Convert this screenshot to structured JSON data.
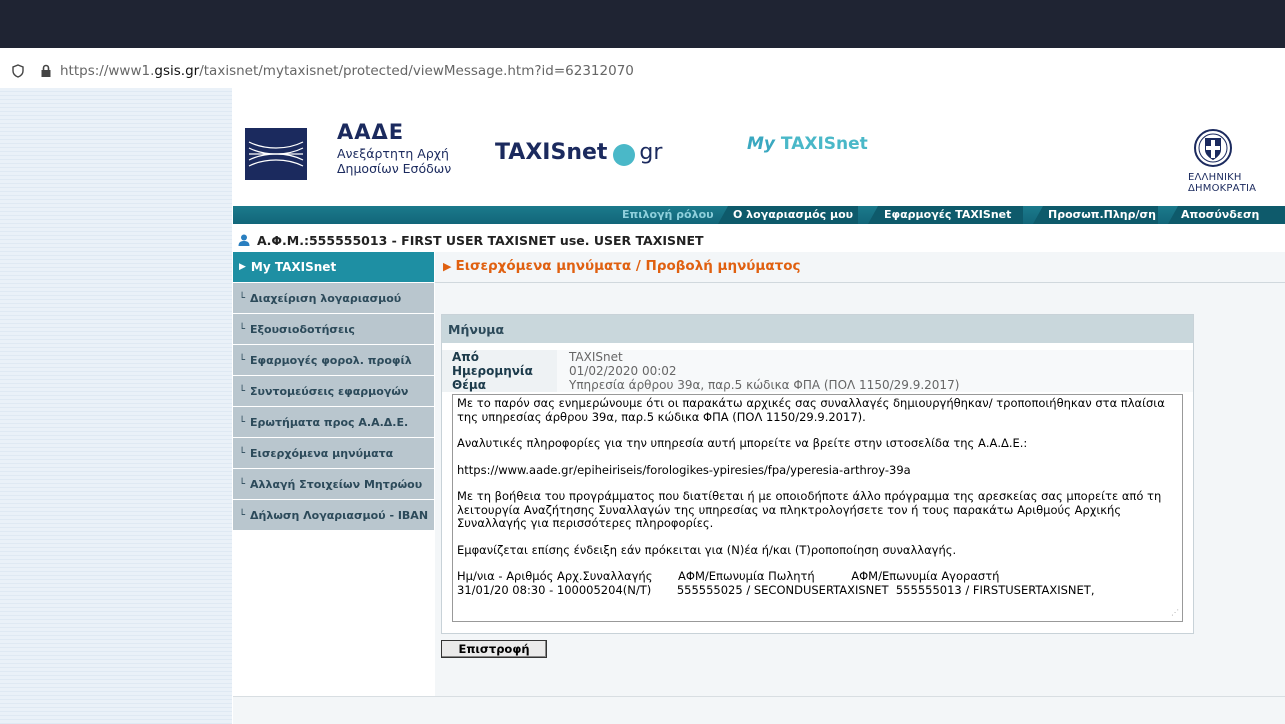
{
  "browser": {
    "url_prefix": "https://www1.",
    "url_domain": "gsis.gr",
    "url_rest": "/taxisnet/mytaxisnet/protected/viewMessage.htm?id=62312070"
  },
  "header": {
    "aade_title": "ΑΑΔΕ",
    "aade_sub1": "Ανεξάρτητη Αρχή",
    "aade_sub2": "Δημοσίων Εσόδων",
    "taxisnet_left": "TAXISnet",
    "taxisnet_right": "gr",
    "mytaxis_my": "My",
    "mytaxis_name": "TAXISnet",
    "emblem_text": "ΕΛΛΗΝΙΚΗ ΔΗΜΟΚΡΑΤΙΑ"
  },
  "nav": {
    "tabs": [
      "Επιλογή ρόλου",
      "Ο λογαριασμός μου",
      "Εφαρμογές TAXISnet",
      "Προσωπ.Πληρ/ση",
      "Αποσύνδεση"
    ]
  },
  "user": {
    "line": "Α.Φ.Μ.:555555013 - FIRST USER TAXISNET use. USER TAXISNET"
  },
  "sidebar": {
    "items": [
      "My TAXISnet",
      "Διαχείριση λογαριασμού",
      "Εξουσιοδοτήσεις",
      "Εφαρμογές φορολ. προφίλ",
      "Συντομεύσεις εφαρμογών",
      "Ερωτήματα προς Α.Α.Δ.Ε.",
      "Εισερχόμενα μηνύματα",
      "Αλλαγή Στοιχείων Μητρώου",
      "Δήλωση Λογαριασμού - IBAN"
    ]
  },
  "main": {
    "breadcrumb": "Εισερχόμενα μηνύματα / Προβολή μηνύματος",
    "panel_title": "Μήνυμα",
    "from_label": "Από",
    "from_value": "TAXISnet",
    "date_label": "Ημερομηνία",
    "date_value": "01/02/2020 00:02",
    "subject_label": "Θέμα",
    "subject_value": "Υπηρεσία άρθρου 39α, παρ.5 κώδικα ΦΠΑ (ΠΟΛ 1150/29.9.2017)",
    "body": {
      "p1": "Με το παρόν σας ενημερώνουμε ότι οι παρακάτω αρχικές σας συναλλαγές δημιουργήθηκαν/ τροποποιήθηκαν στα πλαίσια\nτης υπηρεσίας άρθρου 39α, παρ.5 κώδικα ΦΠΑ (ΠΟΛ 1150/29.9.2017).",
      "p2": "Αναλυτικές πληροφορίες για την υπηρεσία αυτή μπορείτε να βρείτε στην ιστοσελίδα της Α.Α.Δ.Ε.:",
      "p3": "https://www.aade.gr/epiheiriseis/forologikes-ypiresies/fpa/yperesia-arthroy-39a",
      "p4": "Με τη βοήθεια του προγράμματος που διατίθεται ή με οποιοδήποτε άλλο πρόγραμμα της αρεσκείας σας μπορείτε από τη\nλειτουργία Αναζήτησης Συναλλαγών της υπηρεσίας να πληκτρολογήσετε τον ή τους παρακάτω Αριθμούς Αρχικής\nΣυναλλαγής για περισσότερες πληροφορίες.",
      "p5": "Εμφανίζεται επίσης ένδειξη εάν πρόκειται για (Ν)έα ή/και (Τ)ροποποίηση συναλλαγής.",
      "p6": "Ημ/νια - Αριθμός Αρχ.Συναλλαγής       ΑΦΜ/Επωνυμία Πωλητή          ΑΦΜ/Επωνυμία Αγοραστή\n31/01/20 08:30 - 100005204(Ν/Τ)       555555025 / SECONDUSERTAXISNET  555555013 / FIRSTUSERTAXISNET,"
    },
    "back_button": "Επιστροφή"
  },
  "colors": {
    "accent": "#1e8fa3",
    "breadcrumb": "#e06010",
    "brand": "#1b2a5e"
  }
}
